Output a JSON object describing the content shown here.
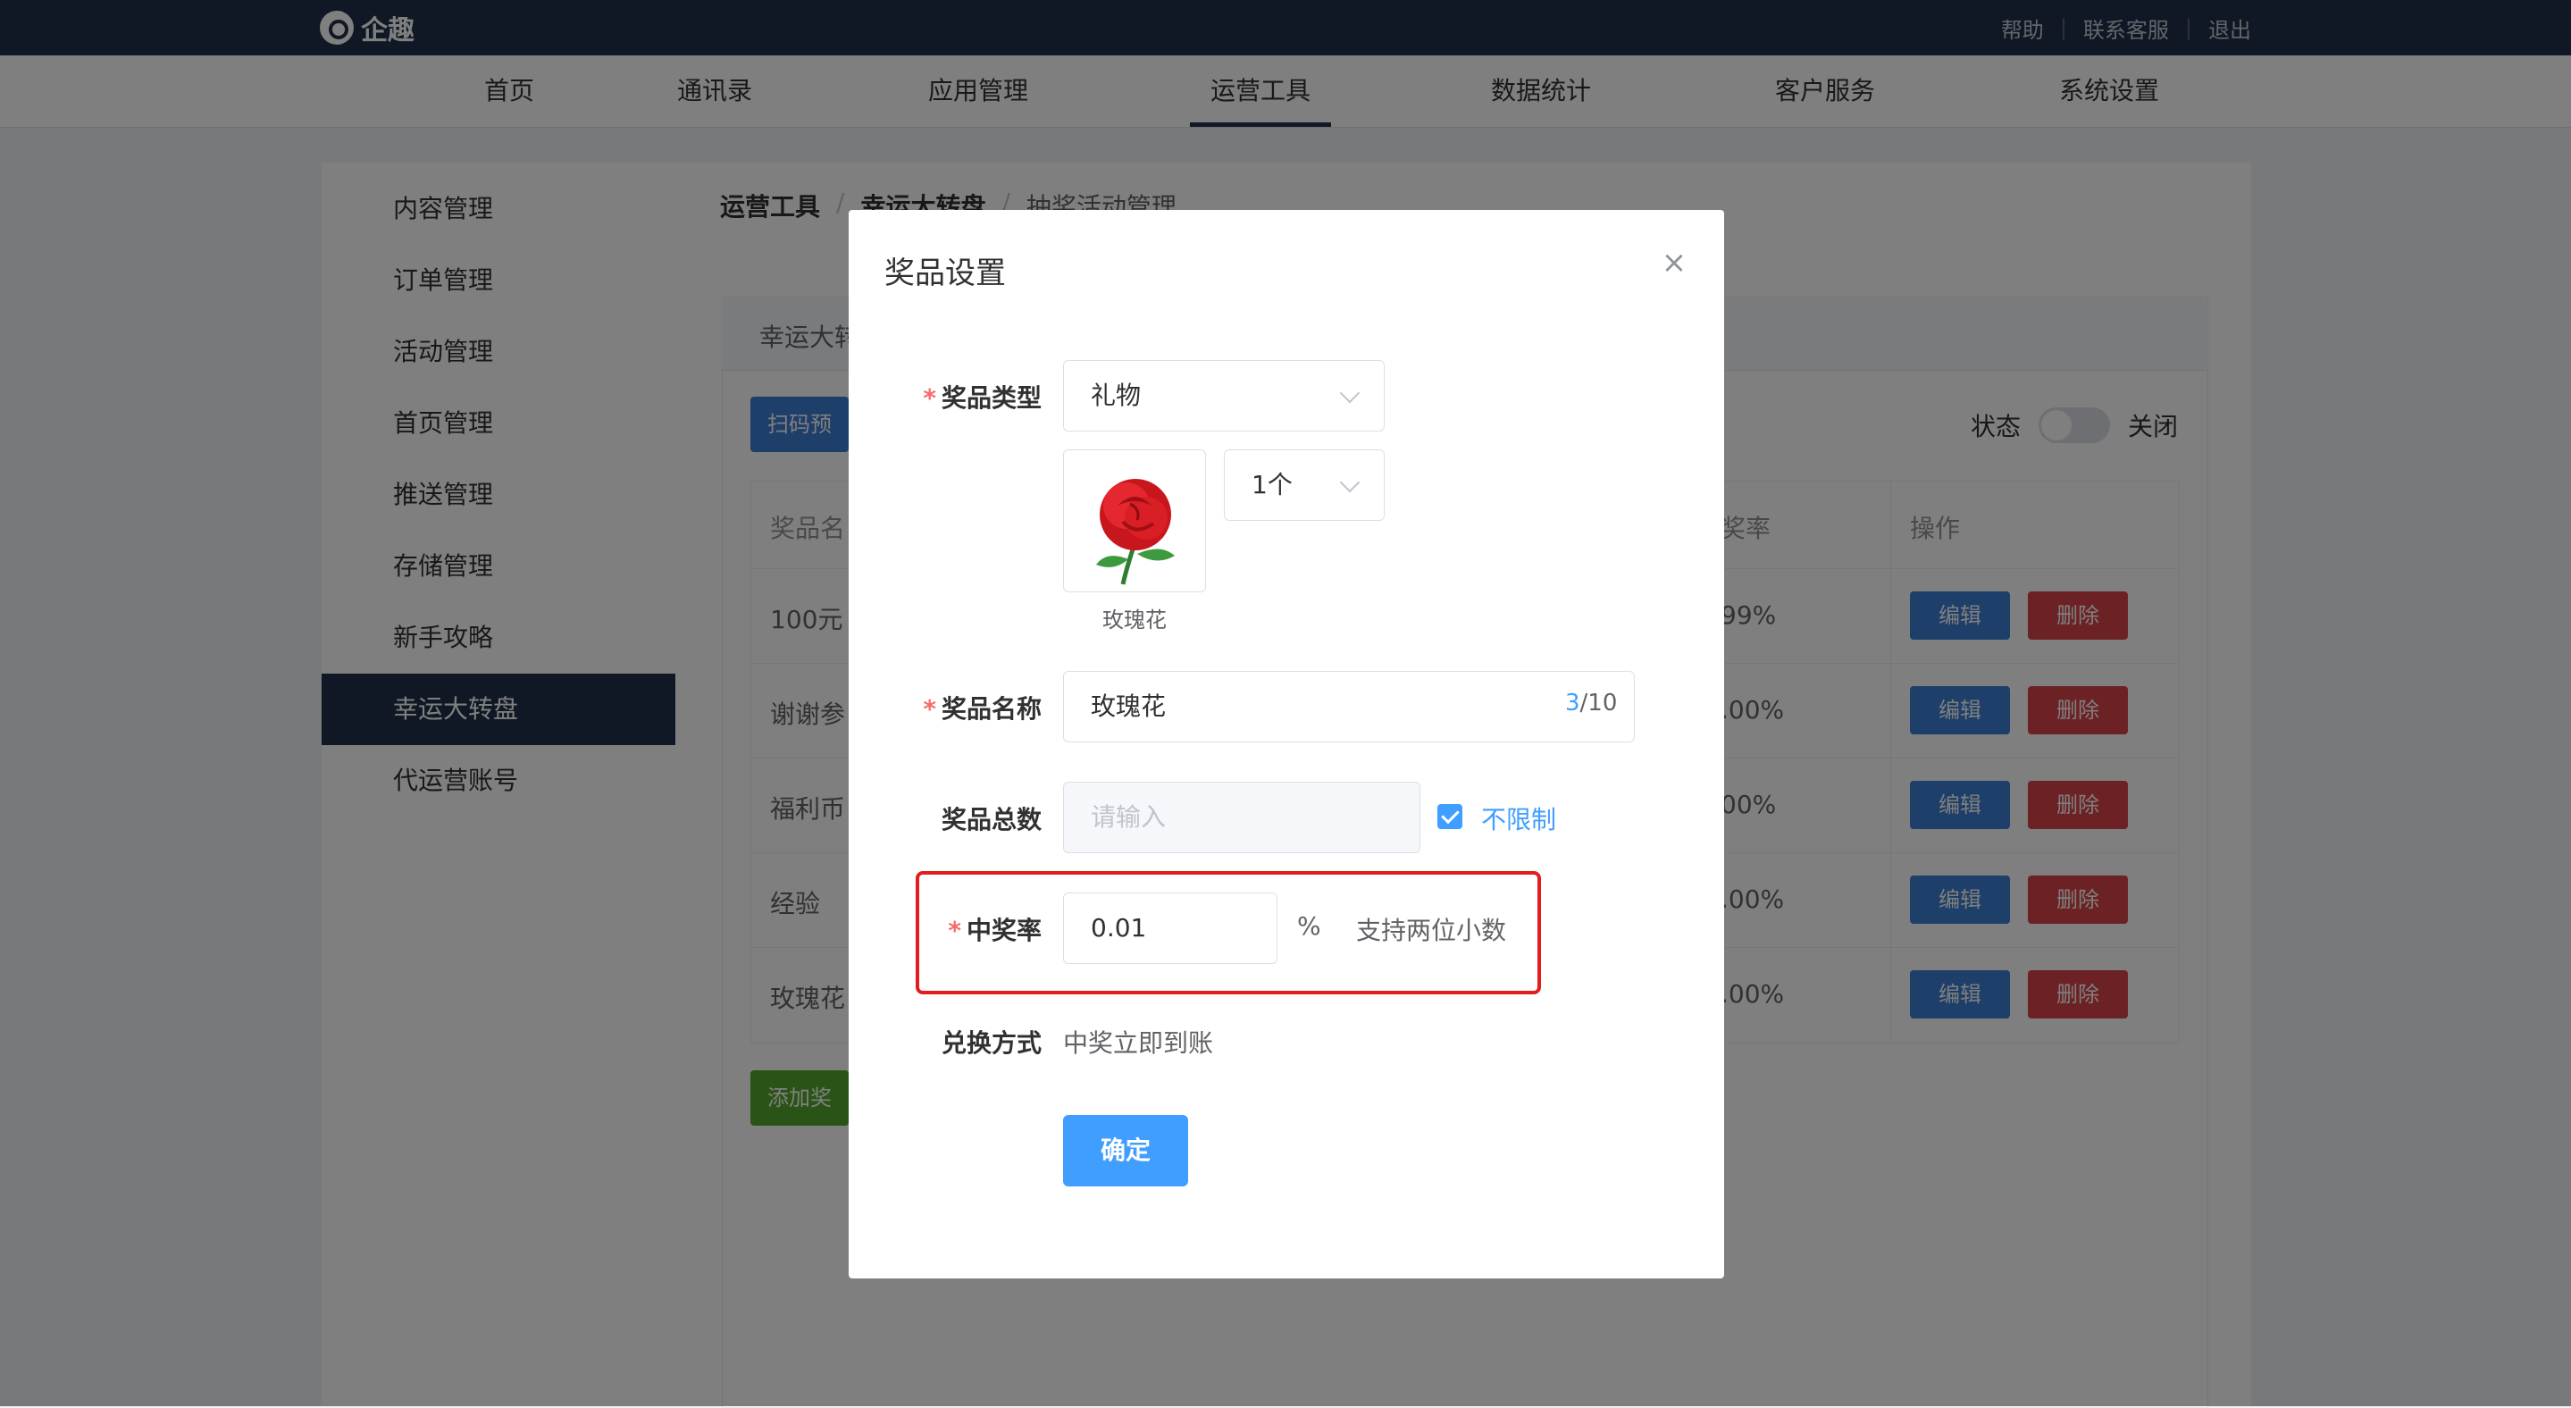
{
  "app": {
    "logo_text": "企趣"
  },
  "top_links": [
    "帮助",
    "联系客服",
    "退出"
  ],
  "nav": {
    "items": [
      "首页",
      "通讯录",
      "应用管理",
      "运营工具",
      "数据统计",
      "客户服务",
      "系统设置"
    ],
    "active": "运营工具"
  },
  "sidebar": {
    "items": [
      "内容管理",
      "订单管理",
      "活动管理",
      "首页管理",
      "推送管理",
      "存储管理",
      "新手攻略",
      "幸运大转盘",
      "代运营账号"
    ],
    "active": "幸运大转盘"
  },
  "breadcrumb": [
    "运营工具",
    "幸运大转盘",
    "抽奖活动管理"
  ],
  "breadcrumb_sep": "/",
  "card": {
    "title": "幸运大转",
    "scan_button": "扫码预",
    "status_label": "状态",
    "status_value": "关闭",
    "add_button": "添加奖"
  },
  "table": {
    "headers": {
      "name": "奖品名",
      "rate": "奖率",
      "action": "操作"
    },
    "rows": [
      {
        "name": "100元",
        "rate": "99%"
      },
      {
        "name": "谢谢参",
        "rate": ".00%"
      },
      {
        "name": "福利币",
        "rate": "00%"
      },
      {
        "name": "经验",
        "rate": ".00%"
      },
      {
        "name": "玫瑰花",
        "rate": ".00%"
      }
    ],
    "edit_label": "编辑",
    "delete_label": "删除"
  },
  "dialog": {
    "title": "奖品设置",
    "close_icon": "close-icon",
    "prize_type": {
      "label": "奖品类型",
      "value": "礼物"
    },
    "gift": {
      "image_icon": "rose-icon",
      "caption": "玫瑰花",
      "quantity": "1个"
    },
    "prize_name": {
      "label": "奖品名称",
      "value": "玫瑰花",
      "count": "3",
      "max": "/10"
    },
    "prize_total": {
      "label": "奖品总数",
      "placeholder": "请输入",
      "unlimited_label": "不限制",
      "unlimited_checked": true
    },
    "win_rate": {
      "label": "中奖率",
      "value": "0.01",
      "unit": "%",
      "hint": "支持两位小数"
    },
    "redeem": {
      "label": "兑换方式",
      "value": "中奖立即到账"
    },
    "confirm_button": "确定"
  },
  "colors": {
    "header": "#1f3049",
    "primary": "#409eff",
    "danger": "#d9454b",
    "highlight": "#e31d1d",
    "required": "#f56c6c"
  }
}
